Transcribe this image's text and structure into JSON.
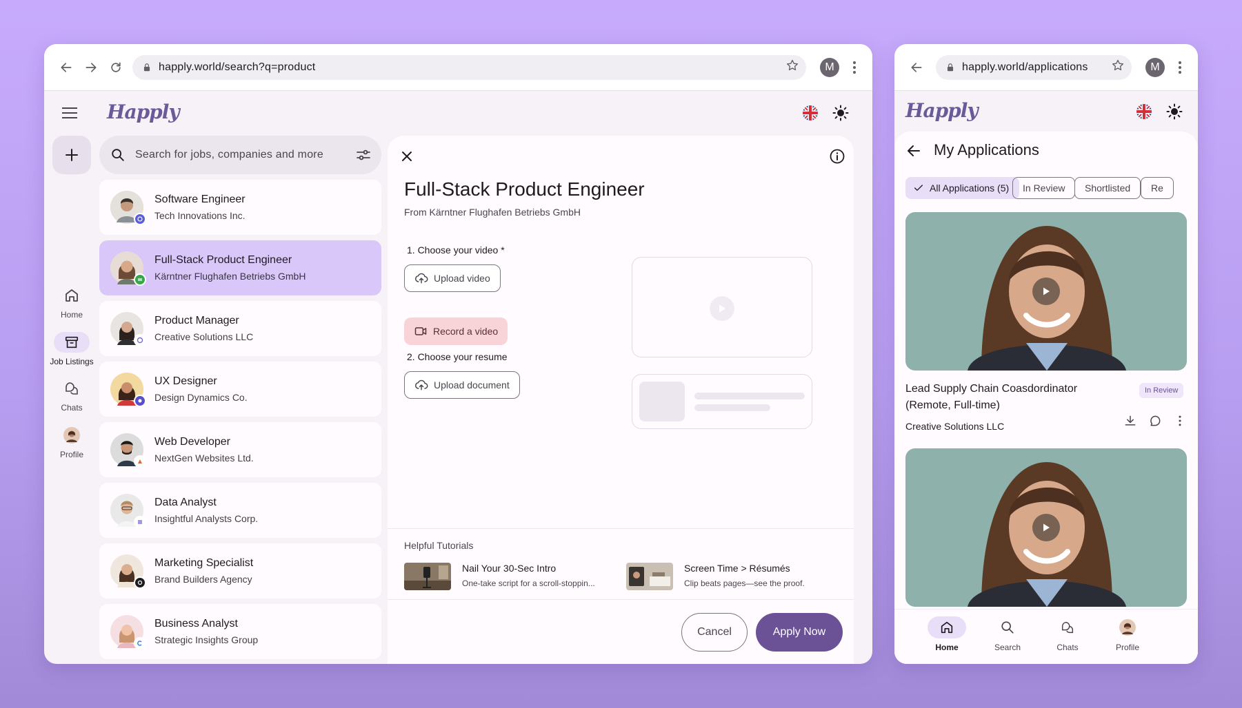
{
  "left_window": {
    "url": "happly.world/search?q=product",
    "profile_initial": "M",
    "logo": "Happly",
    "rail": {
      "home": "Home",
      "job_listings": "Job Listings",
      "chats": "Chats",
      "profile": "Profile"
    },
    "search": {
      "placeholder": "Search for jobs, companies and more"
    },
    "jobs": [
      {
        "title": "Software Engineer",
        "company": "Tech Innovations Inc."
      },
      {
        "title": "Full-Stack Product Engineer",
        "company": "Kärntner Flughafen Betriebs GmbH"
      },
      {
        "title": "Product Manager",
        "company": "Creative Solutions LLC"
      },
      {
        "title": "UX Designer",
        "company": "Design Dynamics Co."
      },
      {
        "title": "Web Developer",
        "company": "NextGen Websites Ltd."
      },
      {
        "title": "Data Analyst",
        "company": "Insightful Analysts Corp."
      },
      {
        "title": "Marketing Specialist",
        "company": "Brand Builders Agency"
      },
      {
        "title": "Business Analyst",
        "company": "Strategic Insights Group"
      }
    ],
    "detail": {
      "title": "Full-Stack Product Engineer",
      "subtitle": "From Kärntner Flughafen Betriebs GmbH",
      "step1": "1. Choose your video *",
      "upload_video": "Upload video",
      "record_video": "Record a video",
      "step2": "2. Choose your resume",
      "upload_document": "Upload document",
      "tutorials_heading": "Helpful Tutorials",
      "tutorials": [
        {
          "title": "Nail Your 30-Sec Intro",
          "desc": "One-take script for a scroll-stoppin..."
        },
        {
          "title": "Screen Time > Résumés",
          "desc": "Clip beats pages—see the proof."
        }
      ],
      "cancel": "Cancel",
      "apply": "Apply Now"
    }
  },
  "right_window": {
    "url": "happly.world/applications",
    "profile_initial": "M",
    "logo": "Happly",
    "heading": "My Applications",
    "chips": [
      "All Applications (5)",
      "In Review",
      "Shortlisted",
      "Re"
    ],
    "application": {
      "title": "Lead Supply Chain Coasdordinator (Remote, Full-time)",
      "status": "In Review",
      "company": "Creative Solutions LLC"
    },
    "bottom_nav": {
      "home": "Home",
      "search": "Search",
      "chats": "Chats",
      "profile": "Profile"
    }
  },
  "colors": {
    "accent": "#6b5195",
    "selected_card": "#d8c7f8",
    "record_button": "#f8d4d8",
    "background": "#c7aafc"
  }
}
